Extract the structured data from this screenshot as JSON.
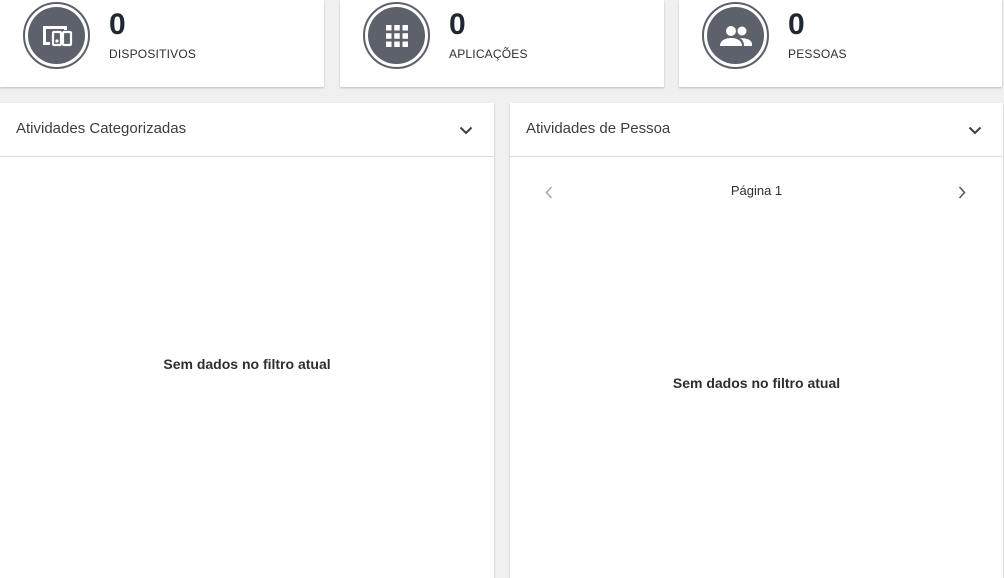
{
  "stats": [
    {
      "value": "0",
      "label": "DISPOSITIVOS",
      "icon": "devices-icon"
    },
    {
      "value": "0",
      "label": "APLICAÇÕES",
      "icon": "apps-grid-icon"
    },
    {
      "value": "0",
      "label": "PESSOAS",
      "icon": "people-icon"
    }
  ],
  "categorized_panel": {
    "title": "Atividades Categorizadas",
    "empty_message": "Sem dados no filtro atual"
  },
  "person_panel": {
    "title": "Atividades de Pessoa",
    "pager_label": "Página 1",
    "empty_message": "Sem dados no filtro atual"
  },
  "colors": {
    "icon_circle": "#5d616b",
    "accent": "#4d7fe0"
  }
}
